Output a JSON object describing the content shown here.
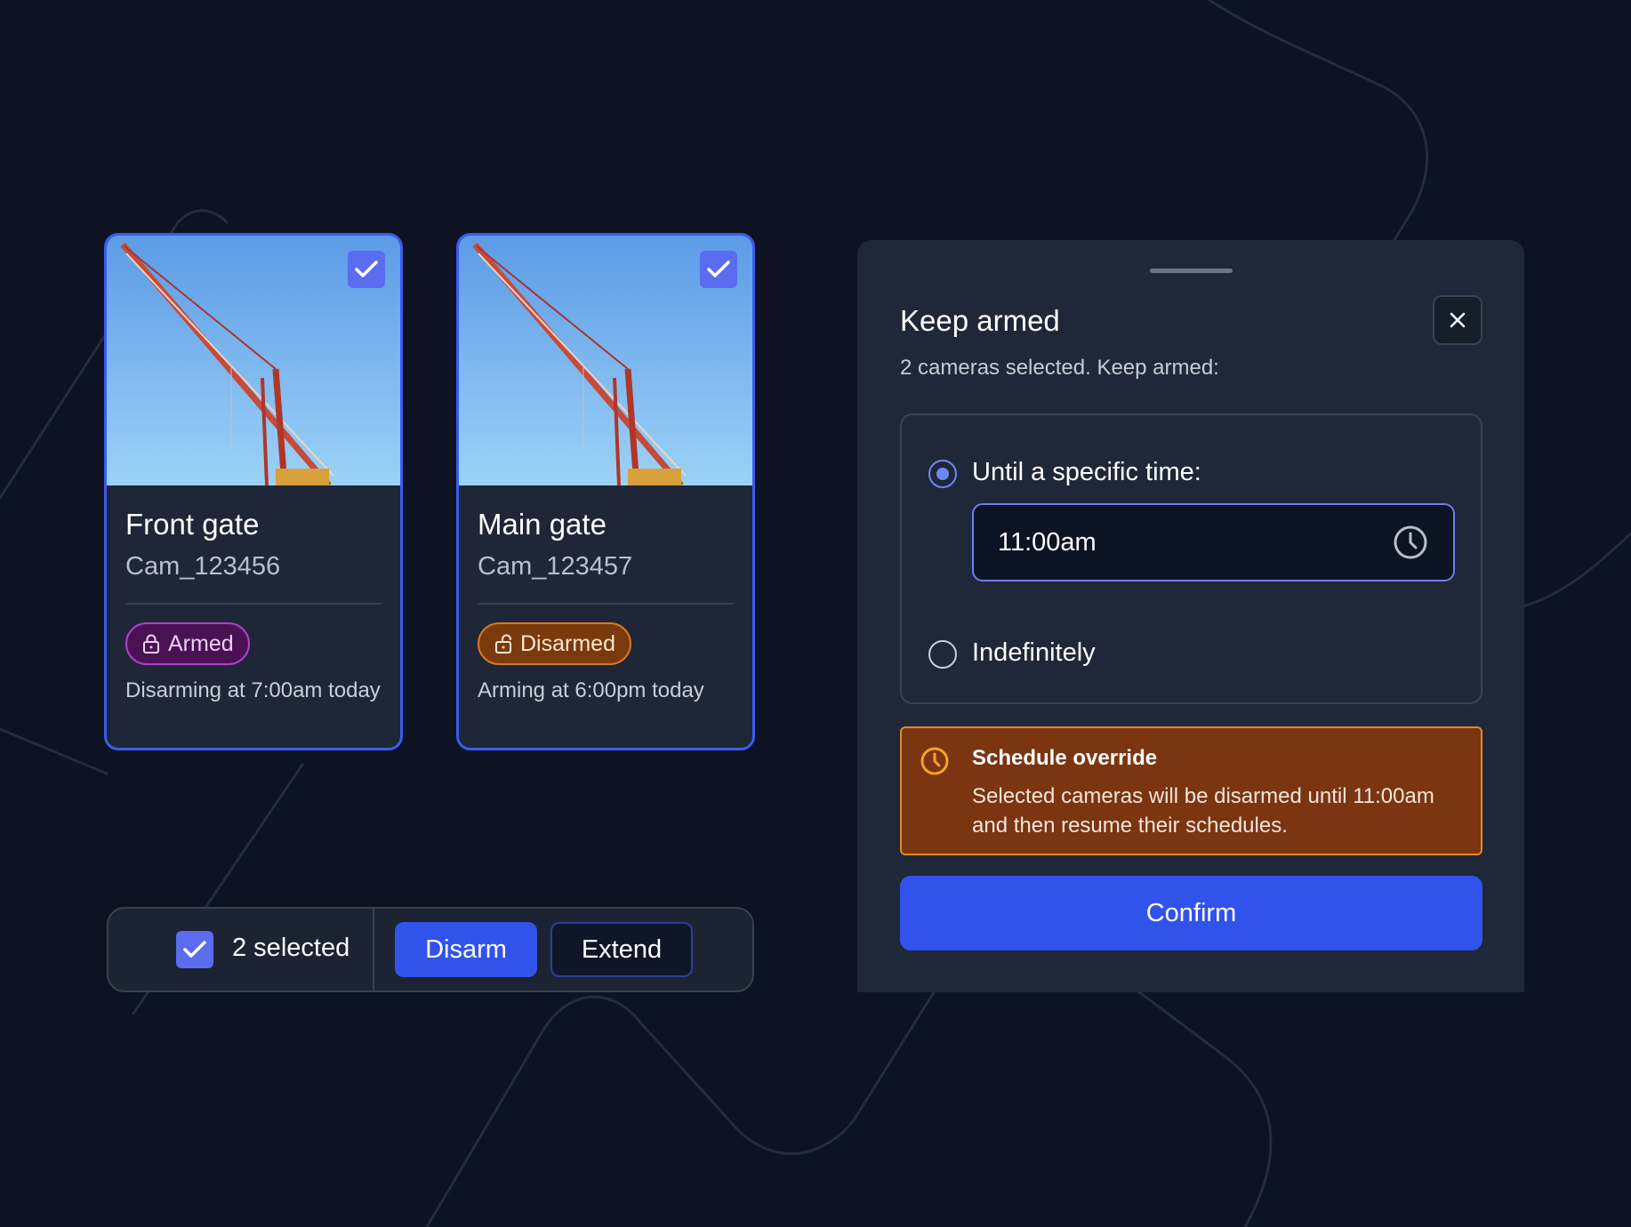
{
  "cameras": [
    {
      "name": "Front gate",
      "id": "Cam_123456",
      "status": "Armed",
      "status_icon": "lock-icon",
      "note": "Disarming at 7:00am today",
      "selected": true
    },
    {
      "name": "Main gate",
      "id": "Cam_123457",
      "status": "Disarmed",
      "status_icon": "unlock-icon",
      "note": "Arming at 6:00pm today",
      "selected": true
    }
  ],
  "toolbar": {
    "count_label": "2 selected",
    "disarm_label": "Disarm",
    "extend_label": "Extend"
  },
  "dialog": {
    "title": "Keep armed",
    "subtitle": "2 cameras selected. Keep armed:",
    "options": [
      {
        "label": "Until a specific time:",
        "selected": true
      },
      {
        "label": "Indefinitely",
        "selected": false
      }
    ],
    "time_value": "11:00am",
    "alert": {
      "title": "Schedule override",
      "text": "Selected cameras will be disarmed until 11:00am and then resume their schedules."
    },
    "confirm_label": "Confirm"
  },
  "colors": {
    "background": "#0d1322",
    "card_border": "#3b5bf0",
    "primary": "#3152eb",
    "armed_badge": "#4a1254",
    "disarmed_badge": "#7a3a0c",
    "alert_bg": "#7b3511",
    "alert_border": "#df8b2a"
  },
  "icons": {
    "close": "close-icon",
    "time": "clock-icon",
    "alert": "clock-warning-icon",
    "check": "checkmark-icon"
  }
}
